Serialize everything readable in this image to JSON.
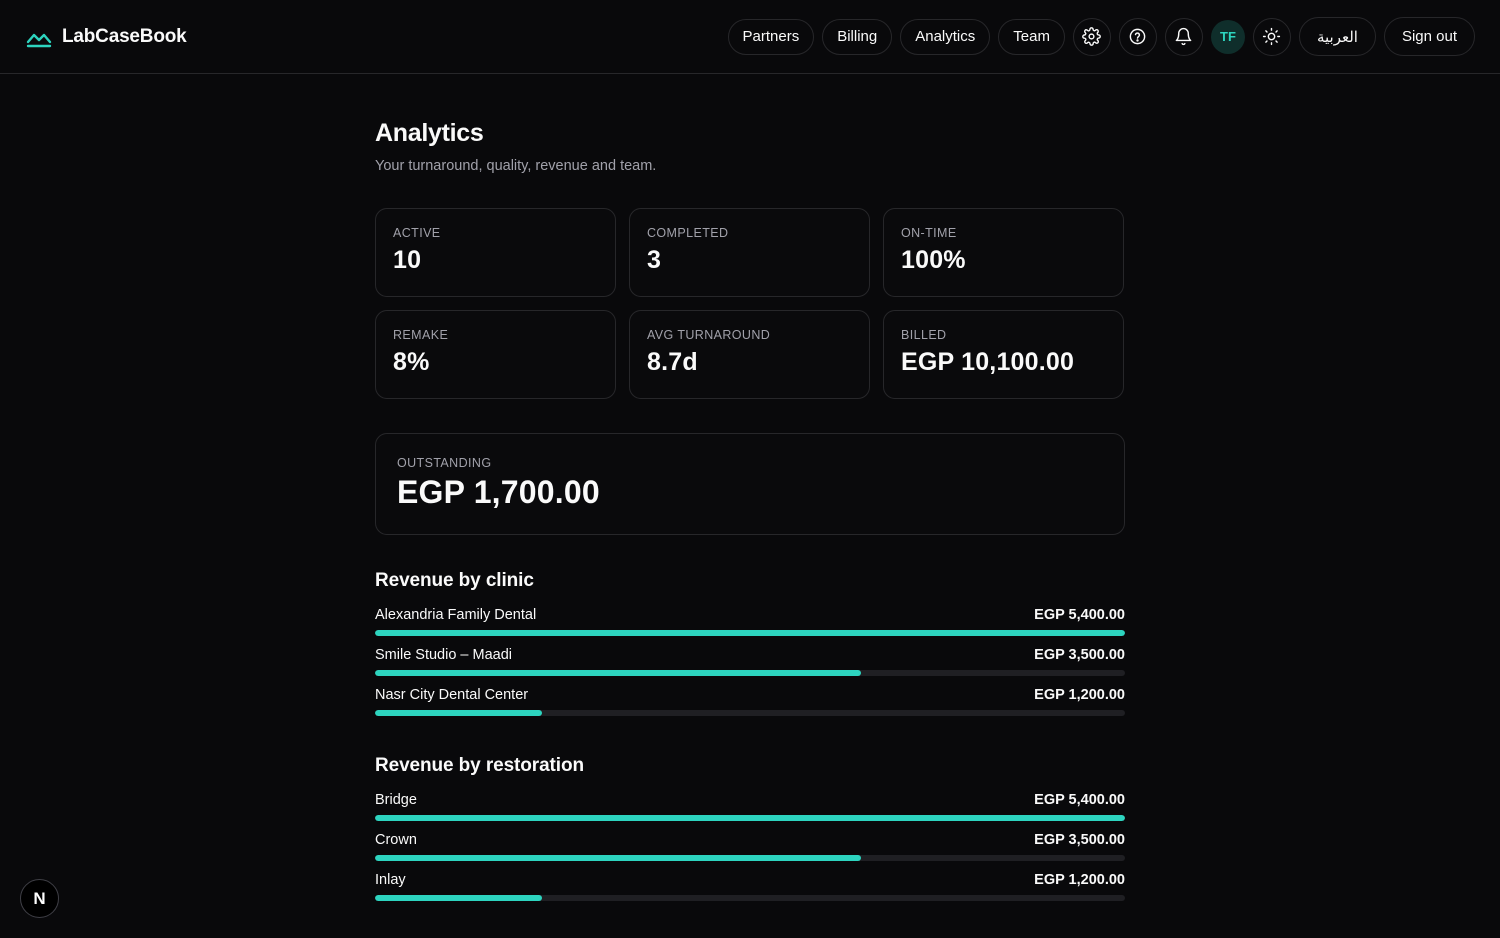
{
  "app": {
    "name": "LabCaseBook"
  },
  "nav": {
    "links": [
      "Partners",
      "Billing",
      "Analytics",
      "Team"
    ],
    "avatar_initials": "TF",
    "language_label": "العربية",
    "signout_label": "Sign out"
  },
  "page": {
    "title": "Analytics",
    "subtitle": "Your turnaround, quality, revenue and team."
  },
  "stats": [
    {
      "label": "ACTIVE",
      "value": "10"
    },
    {
      "label": "COMPLETED",
      "value": "3"
    },
    {
      "label": "ON-TIME",
      "value": "100%"
    },
    {
      "label": "REMAKE",
      "value": "8%"
    },
    {
      "label": "AVG TURNAROUND",
      "value": "8.7d"
    },
    {
      "label": "BILLED",
      "value": "EGP 10,100.00"
    }
  ],
  "outstanding": {
    "label": "OUTSTANDING",
    "value": "EGP 1,700.00"
  },
  "revenue_by_clinic": {
    "title": "Revenue by clinic",
    "rows": [
      {
        "name": "Alexandria Family Dental",
        "value": "EGP 5,400.00",
        "amount": 5400
      },
      {
        "name": "Smile Studio – Maadi",
        "value": "EGP 3,500.00",
        "amount": 3500
      },
      {
        "name": "Nasr City Dental Center",
        "value": "EGP 1,200.00",
        "amount": 1200
      }
    ]
  },
  "revenue_by_restoration": {
    "title": "Revenue by restoration",
    "rows": [
      {
        "name": "Bridge",
        "value": "EGP 5,400.00",
        "amount": 5400
      },
      {
        "name": "Crown",
        "value": "EGP 3,500.00",
        "amount": 3500
      },
      {
        "name": "Inlay",
        "value": "EGP 1,200.00",
        "amount": 1200
      }
    ]
  },
  "dev_badge": {
    "letter": "N"
  },
  "colors": {
    "accent": "#2dd4bf",
    "background": "#09090b",
    "border": "#27272a",
    "muted": "#a1a1aa"
  },
  "icons": [
    "logo-wave-icon",
    "gear-icon",
    "help-icon",
    "bell-icon",
    "sun-icon"
  ]
}
